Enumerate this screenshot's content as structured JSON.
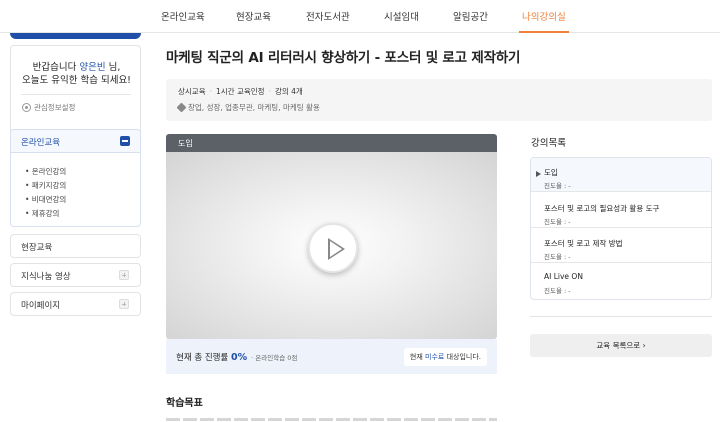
{
  "topnav": {
    "items": [
      "온라인교육",
      "현장교육",
      "전자도서관",
      "시설임대",
      "알림공간",
      "나의강의실"
    ],
    "active_color": "#f0813a"
  },
  "sidebar": {
    "welcome_prefix": "반갑습니다 ",
    "user_name": "양은빈",
    "welcome_suffix": " 님,",
    "welcome_line2": "오늘도 유익한 학습 되세요!",
    "settings_label": "관심정보설정",
    "online_menu": {
      "label": "온라인교육",
      "items": [
        "• 온라인강의",
        "• 패키지강의",
        "• 비대면강의",
        "• 제휴강의"
      ]
    },
    "menus": [
      "현장교육",
      "지식나눔 영상",
      "마이페이지"
    ]
  },
  "course": {
    "title": "마케팅 직군의 AI 리터러시 향상하기 - 포스터 및 로고 제작하기",
    "meta": [
      "상시교육",
      "1시간 교육인정",
      "강의 4개"
    ],
    "tags": "창업, 성장, 업종무관, 마케팅, 마케팅 활용",
    "video_label": "도입",
    "progress_label": "현재 총 진행률",
    "progress_value": "0%",
    "progress_sub": "· 온라인학습 0점",
    "status_prefix": "현재 ",
    "status_highlight": "미수료",
    "status_suffix": " 대상입니다.",
    "section_title": "학습목표"
  },
  "toc": {
    "title": "강의목록",
    "items": [
      {
        "title": "도입",
        "progress": "진도율 : -"
      },
      {
        "title": "포스터 및 로고의 필요성과 활용 도구",
        "progress": "진도율 : -"
      },
      {
        "title": "포스터 및 로고 제작 방법",
        "progress": "진도율 : -"
      },
      {
        "title": "AI Live ON",
        "progress": "진도율 : -"
      }
    ],
    "back_label": "교육 목록으로 ›"
  },
  "colors": {
    "brand_blue": "#1f4fa8",
    "accent_orange": "#f0813a"
  }
}
